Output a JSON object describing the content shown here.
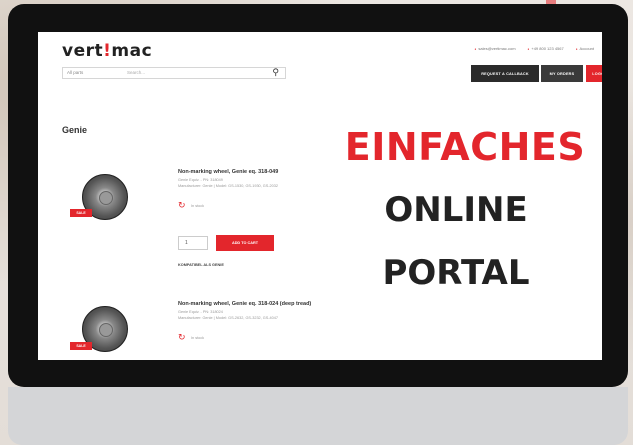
{
  "brand": {
    "logo_prefix": "vert",
    "logo_bang": "!",
    "logo_suffix": "mac"
  },
  "top_links": [
    "sales@vertimac.com",
    "+49 800 123 4567",
    "Account"
  ],
  "search": {
    "category": "All parts",
    "placeholder": "Search..."
  },
  "header_buttons": [
    "REQUEST A CALLBACK",
    "MY ORDERS",
    "LOGOUT"
  ],
  "page_title": "Genie",
  "products": [
    {
      "title": "Non-marking wheel, Genie eq. 318-049",
      "meta1": "Genie Equiv. - PN: 318049",
      "meta2": "Manufacturer: Genie | Model: GS-1530, GS-1930, GS-2032",
      "badge": "SALE",
      "stock": "In stock",
      "qty": "1",
      "cart_label": "ADD TO CART",
      "link": "KOMPATIBEL ALS GENIE"
    },
    {
      "title": "Non-marking wheel, Genie eq. 318-024 (deep tread)",
      "meta1": "Genie Equiv. - PN: 318024",
      "meta2": "Manufacturer: Genie | Model: GS-2632, GS-3232, GS-4047",
      "badge": "SALE",
      "stock": "In stock"
    }
  ],
  "overlay": {
    "line1": "EINFACHES",
    "line2": "ONLINE",
    "line3": "PORTAL"
  },
  "colors": {
    "accent": "#e3262c",
    "bezel": "#111111",
    "chin": "#d4d5d7"
  }
}
